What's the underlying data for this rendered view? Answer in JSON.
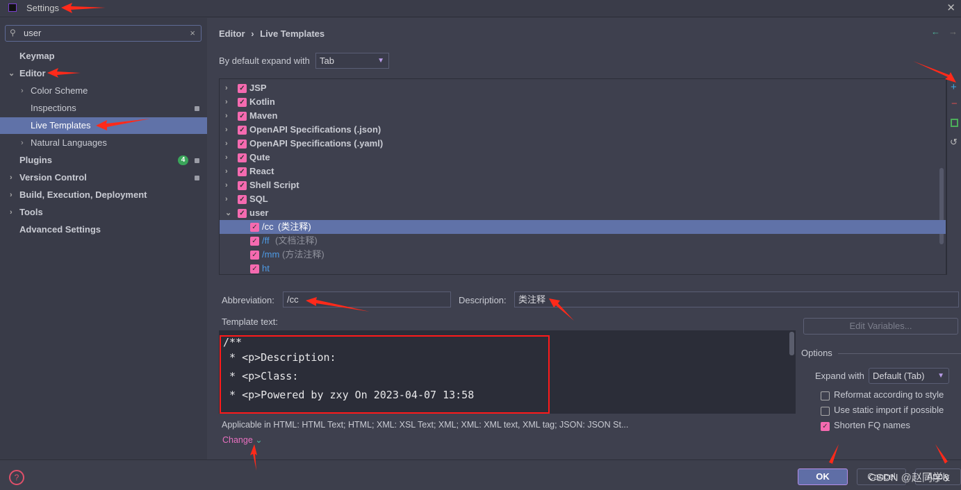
{
  "window": {
    "title": "Settings"
  },
  "search": {
    "value": "user"
  },
  "sidebar": {
    "items": [
      {
        "label": "Keymap"
      },
      {
        "label": "Editor"
      },
      {
        "label": "Color Scheme"
      },
      {
        "label": "Inspections"
      },
      {
        "label": "Live Templates"
      },
      {
        "label": "Natural Languages"
      },
      {
        "label": "Plugins",
        "badge": "4"
      },
      {
        "label": "Version Control"
      },
      {
        "label": "Build, Execution, Deployment"
      },
      {
        "label": "Tools"
      },
      {
        "label": "Advanced Settings"
      }
    ]
  },
  "breadcrumb": {
    "parent": "Editor",
    "sep": "›",
    "current": "Live Templates"
  },
  "expand_default": {
    "label": "By default expand with",
    "value": "Tab"
  },
  "tree": {
    "groups": [
      "JSP",
      "Kotlin",
      "Maven",
      "OpenAPI Specifications (.json)",
      "OpenAPI Specifications (.yaml)",
      "Qute",
      "React",
      "Shell Script",
      "SQL",
      "user"
    ],
    "templates": [
      {
        "abbr": "/cc",
        "desc": "(类注释)"
      },
      {
        "abbr": "/ff",
        "desc": "(文档注释)"
      },
      {
        "abbr": "/mm",
        "desc": "(方法注释)"
      },
      {
        "abbr": "ht",
        "desc": ""
      }
    ]
  },
  "form": {
    "abbreviation_label": "Abbreviation:",
    "abbreviation": "/cc",
    "description_label": "Description:",
    "description": "类注释",
    "template_label": "Template text:",
    "template_lines": [
      "/**",
      " * <p>Description:",
      " * <p>Class:",
      " * <p>Powered by zxy On 2023-04-07 13:58"
    ],
    "applicable": "Applicable in HTML: HTML Text; HTML; XML: XSL Text; XML; XML: XML text, XML tag; JSON: JSON St...",
    "change": "Change"
  },
  "options": {
    "edit_variables": "Edit Variables...",
    "title": "Options",
    "expand_label": "Expand with",
    "expand_value": "Default (Tab)",
    "checks": [
      {
        "label": "Reformat according to style",
        "checked": false
      },
      {
        "label": "Use static import if possible",
        "checked": false
      },
      {
        "label": "Shorten FQ names",
        "checked": true
      }
    ]
  },
  "footer": {
    "ok": "OK",
    "cancel": "Cancel",
    "apply": "Apply",
    "watermark": "CSDN @赵同学&"
  },
  "colors": {
    "accent": "#6072a8",
    "checkbox": "#f56ab0",
    "annotation_arrow": "#ff2a1a"
  }
}
